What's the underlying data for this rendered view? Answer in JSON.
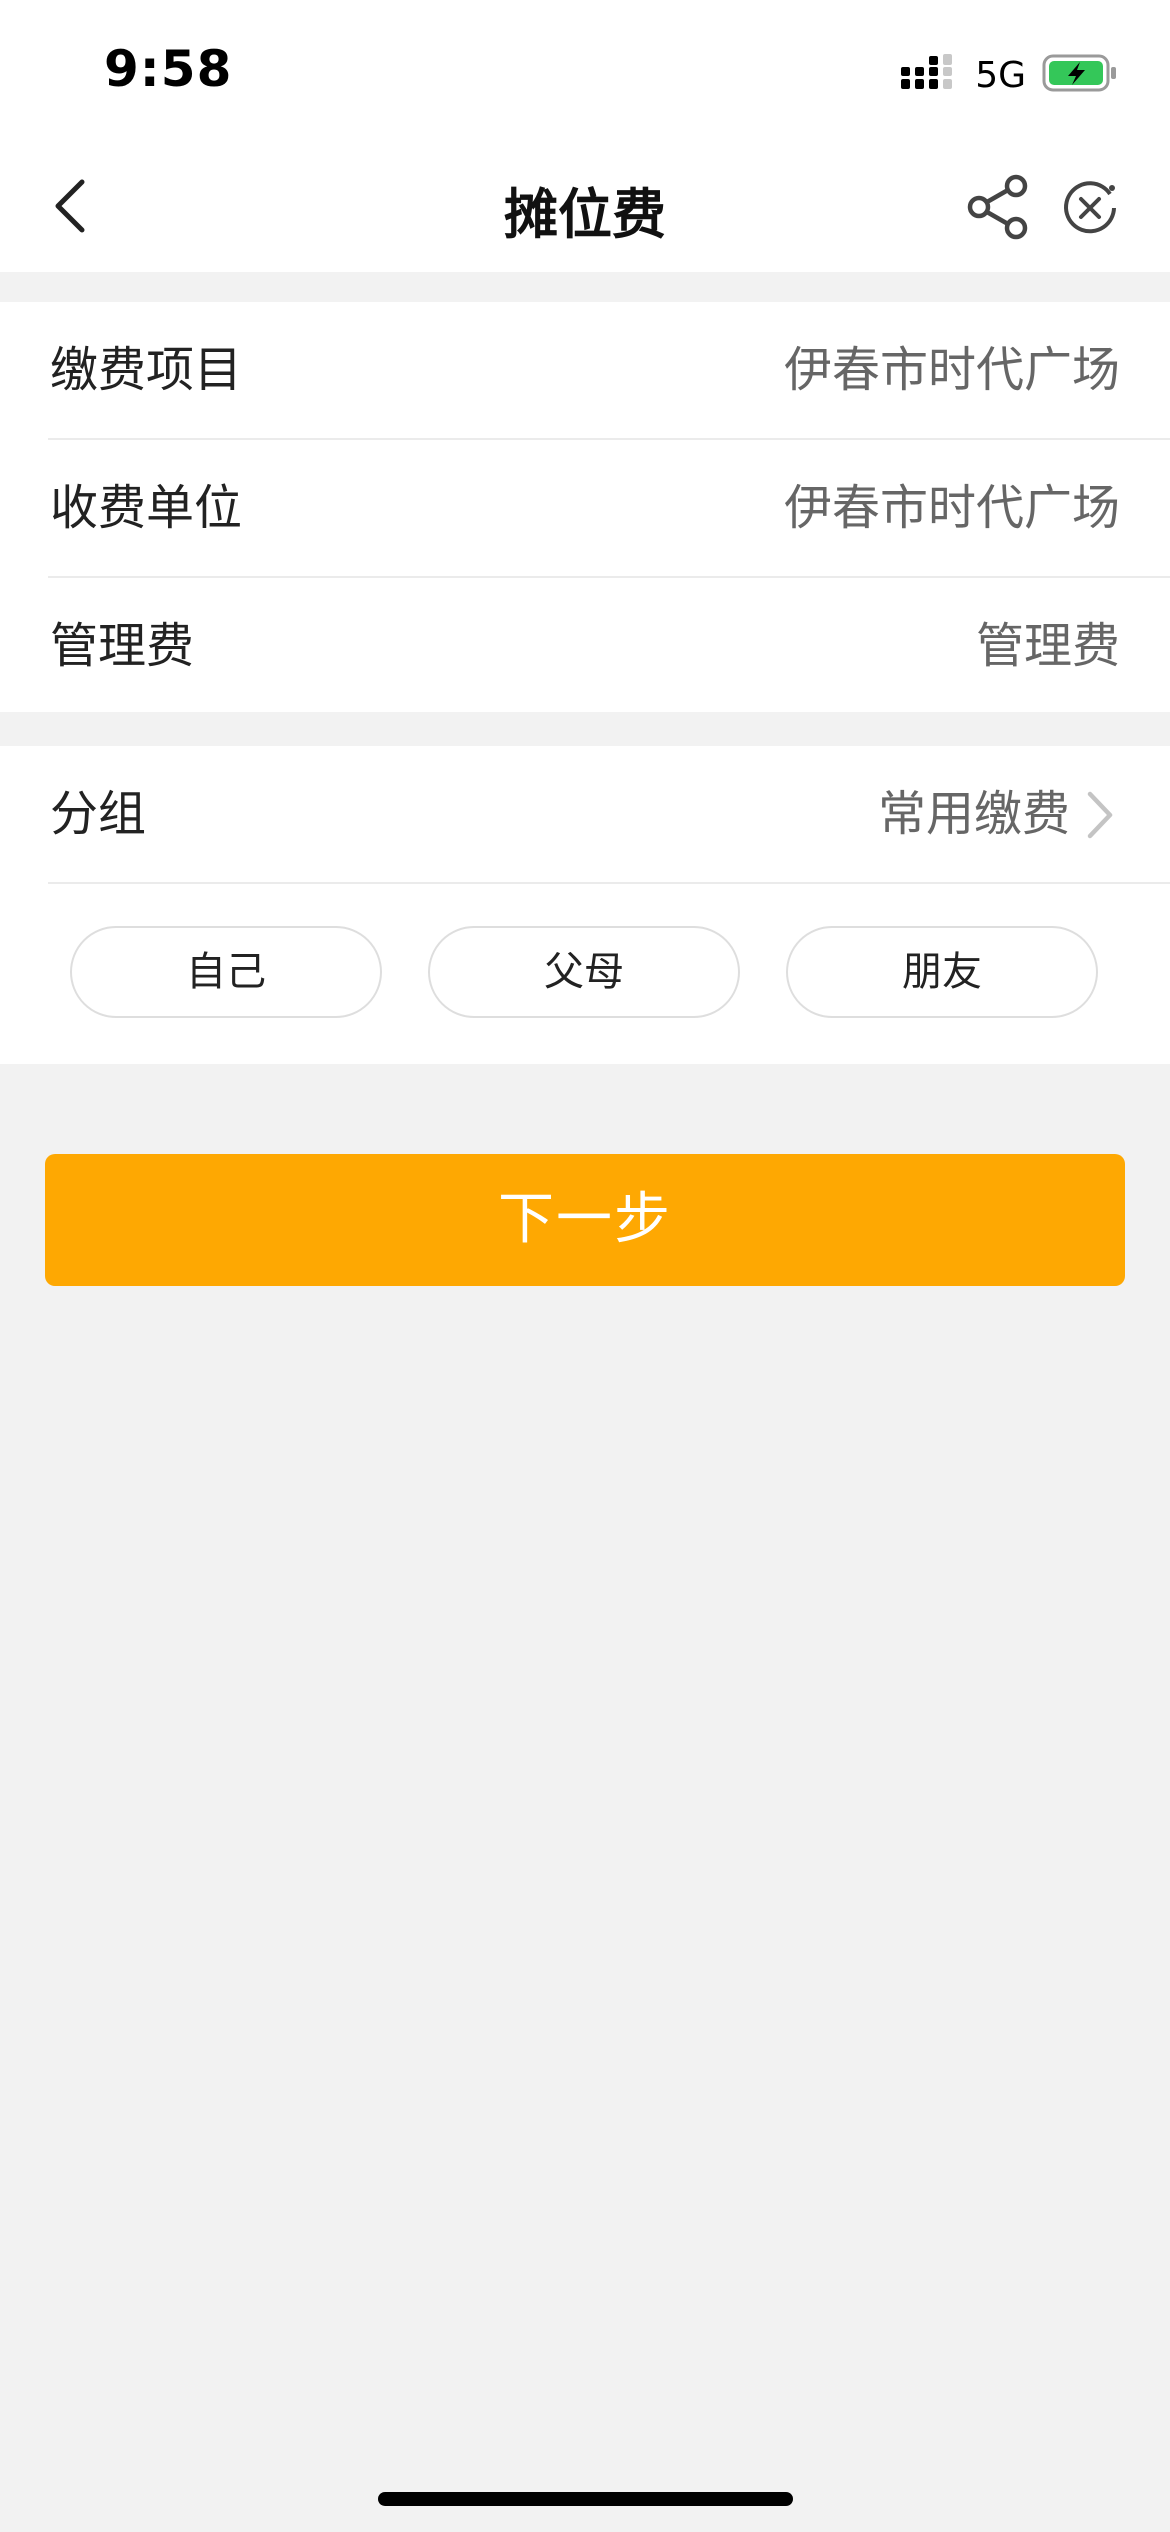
{
  "status_bar": {
    "time": "9:58",
    "network": "5G",
    "icons": [
      "signal-icon",
      "battery-charging-icon"
    ]
  },
  "nav": {
    "title": "摊位费",
    "icons": [
      "chevron-left-icon",
      "share-icon",
      "close-circle-icon"
    ]
  },
  "details": [
    {
      "label": "缴费项目",
      "value": "伊春市时代广场"
    },
    {
      "label": "收费单位",
      "value": "伊春市时代广场"
    },
    {
      "label": "管理费",
      "value": "管理费"
    }
  ],
  "group": {
    "label": "分组",
    "value": "常用缴费",
    "options": [
      "自己",
      "父母",
      "朋友"
    ]
  },
  "actions": {
    "next_label": "下一步"
  },
  "colors": {
    "accent": "#fea802",
    "background": "#f2f2f2",
    "battery_green": "#34c759"
  }
}
